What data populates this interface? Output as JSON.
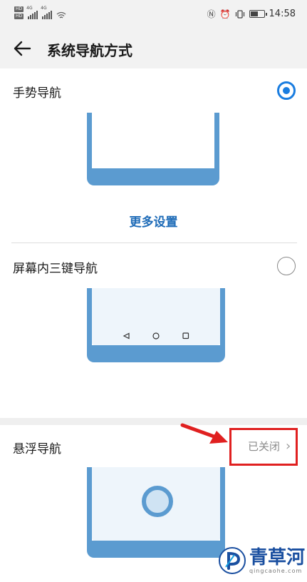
{
  "status_bar": {
    "hd_1": "HD",
    "hd_2": "HD",
    "sim1_tech": "4G",
    "sim2_tech": "4G",
    "time": "14:58",
    "battery_level": 0.6,
    "icons": [
      "nfc-icon",
      "alarm-icon",
      "vibrate-icon",
      "battery-icon"
    ]
  },
  "app_bar": {
    "title": "系统导航方式",
    "back_icon": "arrow-left-icon"
  },
  "options": {
    "gesture": {
      "label": "手势导航",
      "selected": true,
      "more_settings": "更多设置"
    },
    "three_key": {
      "label": "屏幕内三键导航",
      "selected": false,
      "keys": [
        "◁",
        "○",
        "□"
      ]
    },
    "floating": {
      "label": "悬浮导航",
      "status": "已关闭",
      "chevron_icon": "chevron-right-icon"
    }
  },
  "watermark": {
    "brand": "青草河",
    "domain": "qingcaohe.com"
  },
  "colors": {
    "accent": "#1a7de0",
    "phone_frame": "#5b9bd0",
    "link": "#1f6cb8",
    "highlight": "#e02020"
  }
}
